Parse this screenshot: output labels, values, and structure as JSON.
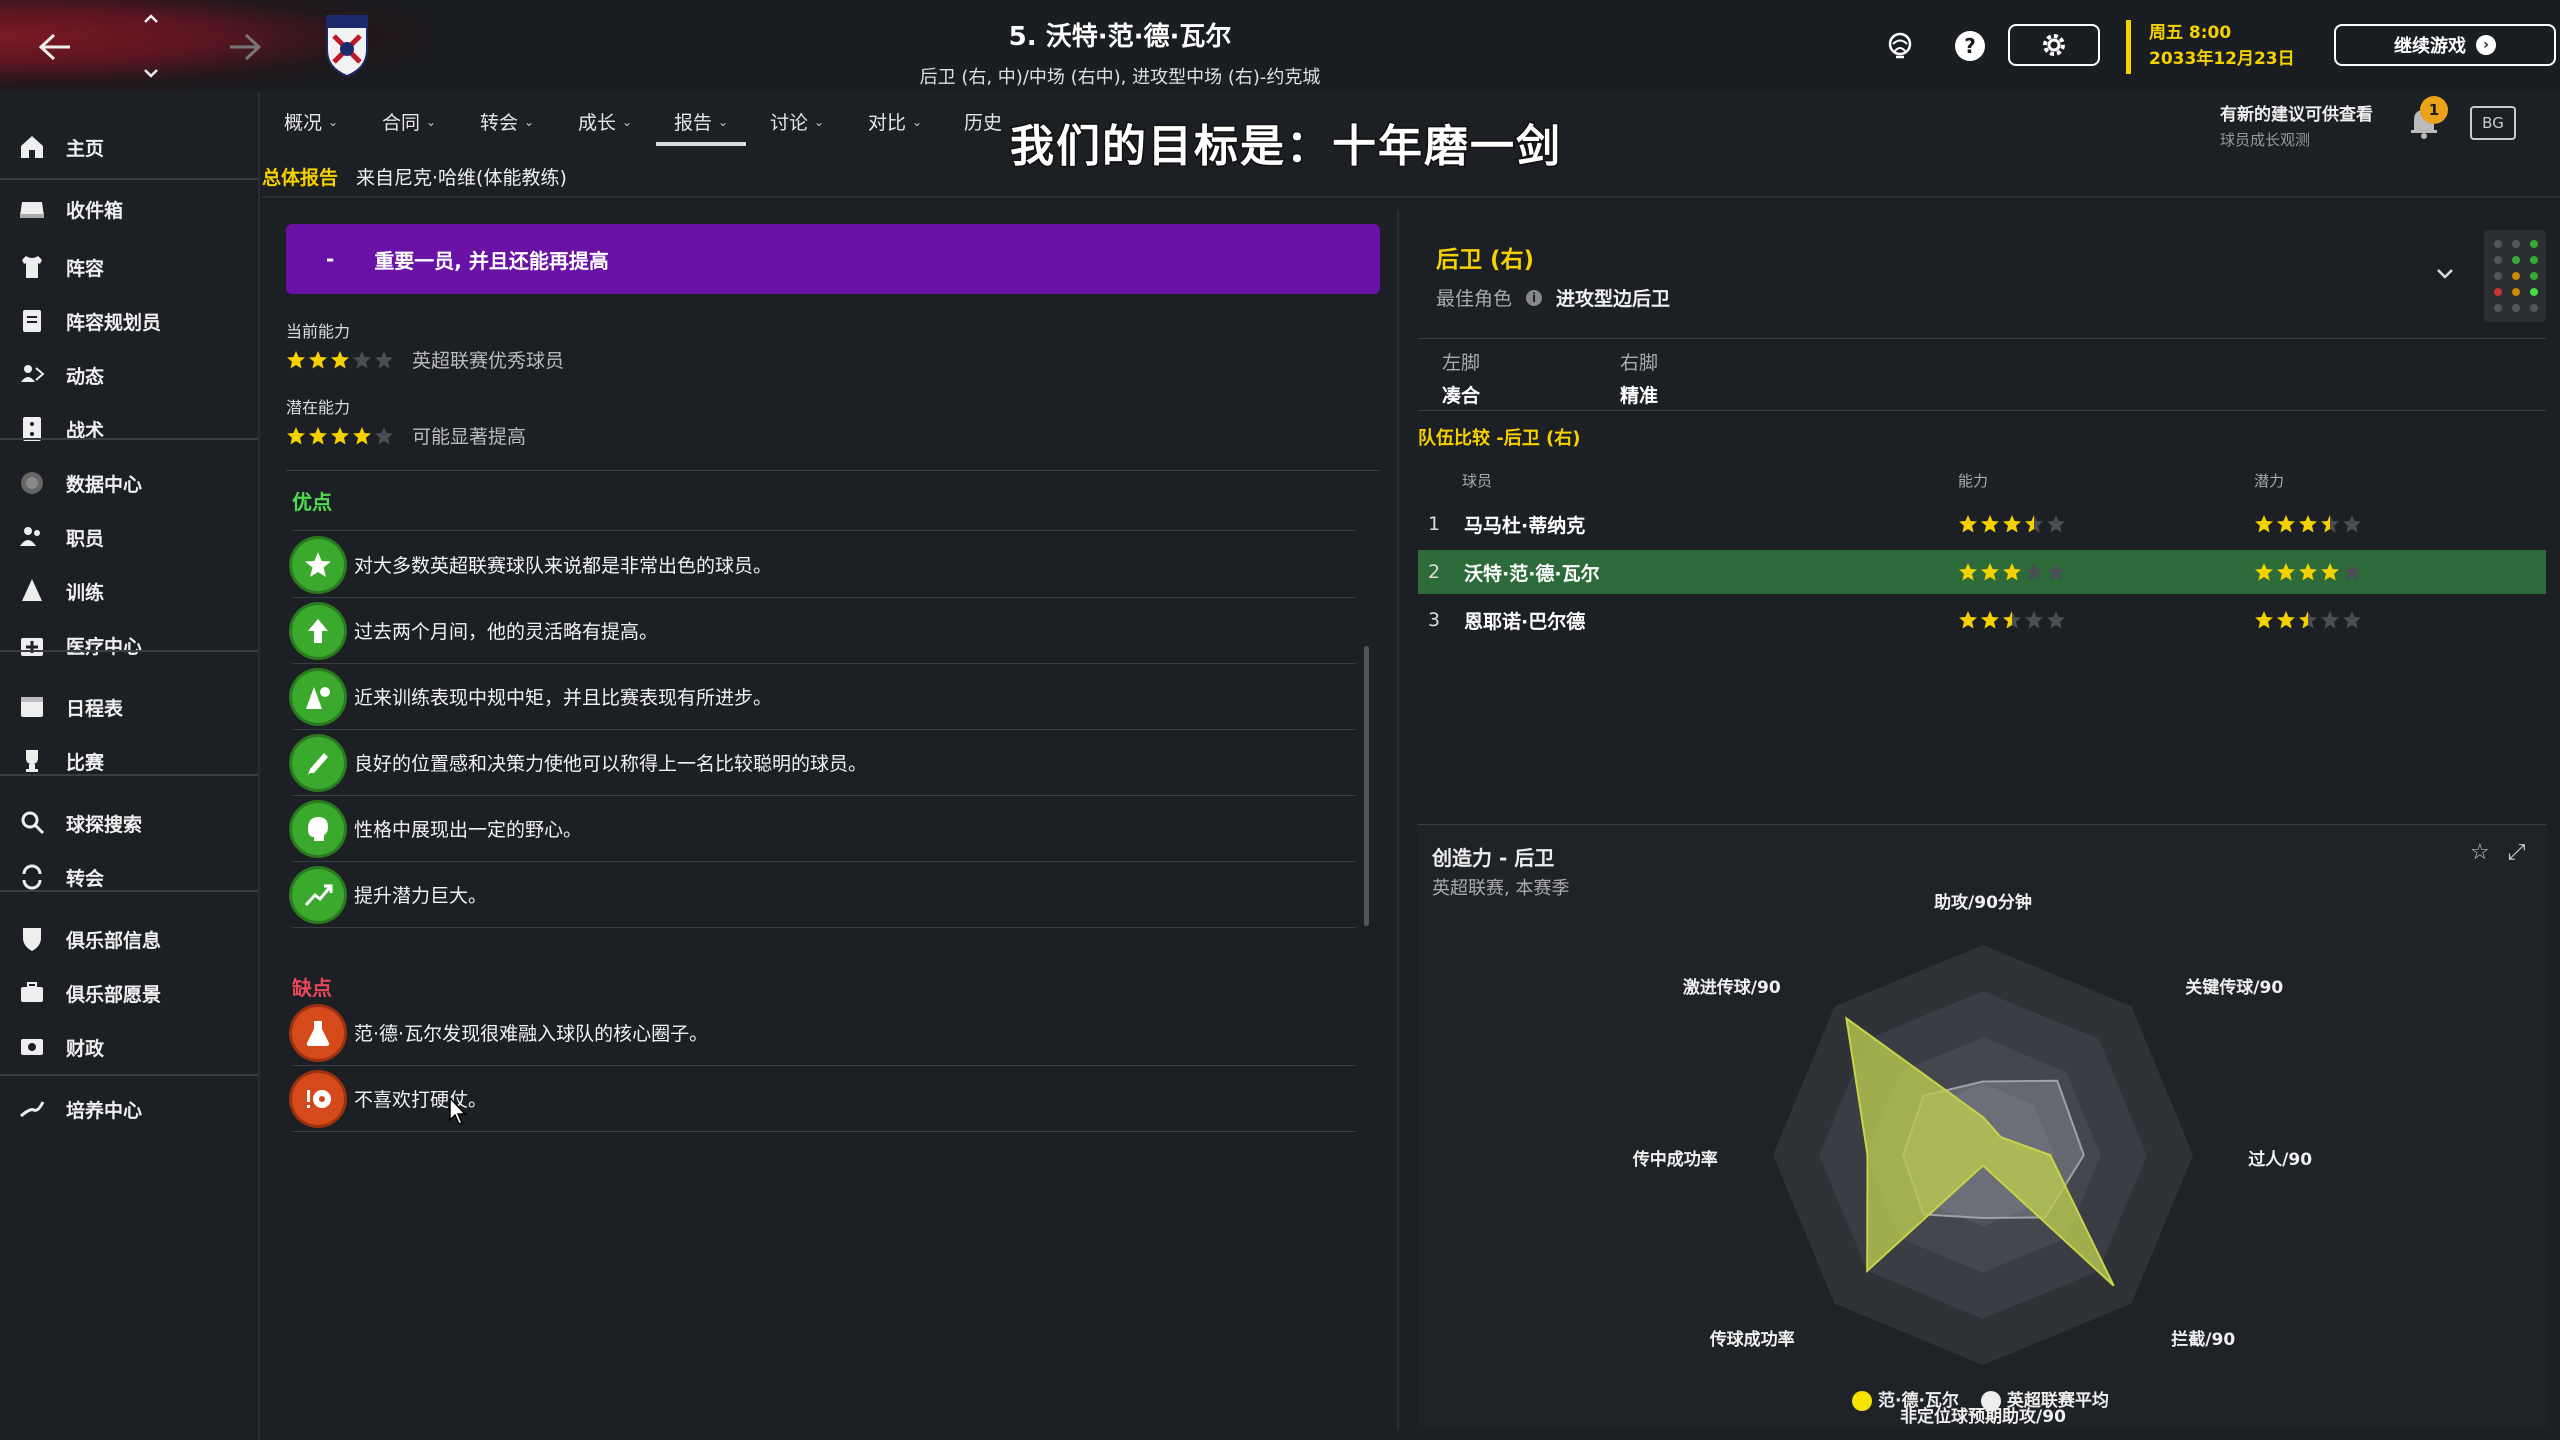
{
  "header": {
    "title": "5. 沃特·范·德·瓦尔",
    "subtitle": "后卫 (右, 中)/中场 (右中), 进攻型中场 (右)-约克城",
    "date_line1": "周五 8:00",
    "date_line2": "2033年12月23日",
    "continue_label": "继续游戏"
  },
  "sidebar": {
    "items": [
      {
        "label": "主页",
        "icon": "home-icon"
      },
      {
        "label": "收件箱",
        "icon": "inbox-icon"
      },
      {
        "label": "阵容",
        "icon": "shirt-icon"
      },
      {
        "label": "阵容规划员",
        "icon": "clipboard-icon"
      },
      {
        "label": "动态",
        "icon": "dynamics-icon"
      },
      {
        "label": "战术",
        "icon": "tactics-icon"
      },
      {
        "label": "数据中心",
        "icon": "data-hub-icon"
      },
      {
        "label": "职员",
        "icon": "staff-icon"
      },
      {
        "label": "训练",
        "icon": "training-icon"
      },
      {
        "label": "医疗中心",
        "icon": "medical-icon"
      },
      {
        "label": "日程表",
        "icon": "calendar-icon"
      },
      {
        "label": "比赛",
        "icon": "trophy-icon"
      },
      {
        "label": "球探搜索",
        "icon": "search-icon"
      },
      {
        "label": "转会",
        "icon": "transfer-icon"
      },
      {
        "label": "俱乐部信息",
        "icon": "shield-icon"
      },
      {
        "label": "俱乐部愿景",
        "icon": "briefcase-icon"
      },
      {
        "label": "财政",
        "icon": "finance-icon"
      },
      {
        "label": "培养中心",
        "icon": "development-icon"
      }
    ]
  },
  "tabs": [
    "概况",
    "合同",
    "转会",
    "成长",
    "报告",
    "讨论",
    "对比",
    "历史"
  ],
  "overlay_text": "我们的目标是：十年磨一剑",
  "breadcrumb": {
    "section": "总体报告",
    "source": "来自尼克·哈维(体能教练)"
  },
  "notification": {
    "title": "有新的建议可供查看",
    "sub": "球员成长观测",
    "count": "1"
  },
  "bg_label": "BG",
  "report": {
    "banner_dash": "-",
    "banner": "重要一员, 并且还能再提高",
    "current_label": "当前能力",
    "current_stars": 3,
    "current_desc": "英超联赛优秀球员",
    "potential_label": "潜在能力",
    "potential_stars": 4,
    "potential_desc": "可能显著提高",
    "strengths_title": "优点",
    "strengths": [
      {
        "text": "对大多数英超联赛球队来说都是非常出色的球员。",
        "icon": "star-icon"
      },
      {
        "text": "过去两个月间，他的灵活略有提高。",
        "icon": "agility-up-icon"
      },
      {
        "text": "近来训练表现中规中矩，并且比赛表现有所进步。",
        "icon": "training-cone-icon"
      },
      {
        "text": "良好的位置感和决策力使他可以称得上一名比较聪明的球员。",
        "icon": "pencil-icon"
      },
      {
        "text": "性格中展现出一定的野心。",
        "icon": "head-icon"
      },
      {
        "text": "提升潜力巨大。",
        "icon": "trend-up-icon"
      }
    ],
    "weaknesses_title": "缺点",
    "weaknesses": [
      {
        "text": "范·德·瓦尔发现很难融入球队的核心圈子。",
        "icon": "flask-icon"
      },
      {
        "text": "不喜欢打硬仗。",
        "icon": "ball-alert-icon"
      }
    ]
  },
  "position": {
    "title": "后卫 (右)",
    "best_role_label": "最佳角色",
    "best_role": "进攻型边后卫",
    "left_foot_label": "左脚",
    "left_foot": "凑合",
    "right_foot_label": "右脚",
    "right_foot": "精准"
  },
  "comparison": {
    "title": "队伍比较 -后卫 (右)",
    "col_player": "球员",
    "col_ability": "能力",
    "col_potential": "潜力",
    "rows": [
      {
        "num": "1",
        "name": "马马杜·蒂纳克",
        "ability": 3.5,
        "potential": 3.5
      },
      {
        "num": "2",
        "name": "沃特·范·德·瓦尔",
        "ability": 3,
        "potential": 4
      },
      {
        "num": "3",
        "name": "恩耶诺·巴尔德",
        "ability": 2.5,
        "potential": 2.5
      }
    ]
  },
  "chart_data": {
    "type": "radar",
    "title": "创造力 - 后卫",
    "subtitle": "英超联赛, 本赛季",
    "axes": [
      "助攻/90分钟",
      "关键传球/90",
      "过人/90",
      "拦截/90",
      "非定位球预期助攻/90",
      "传球成功率",
      "传中成功率",
      "激进传球/90"
    ],
    "series": [
      {
        "name": "范·德·瓦尔",
        "color": "#c7d34a",
        "values": [
          0.18,
          0.12,
          0.32,
          0.88,
          0.05,
          0.78,
          0.55,
          0.92
        ]
      },
      {
        "name": "英超联赛平均",
        "color": "#e8e8e8",
        "values": [
          0.35,
          0.5,
          0.48,
          0.42,
          0.3,
          0.4,
          0.38,
          0.4
        ]
      }
    ],
    "range": [
      0,
      1
    ]
  }
}
